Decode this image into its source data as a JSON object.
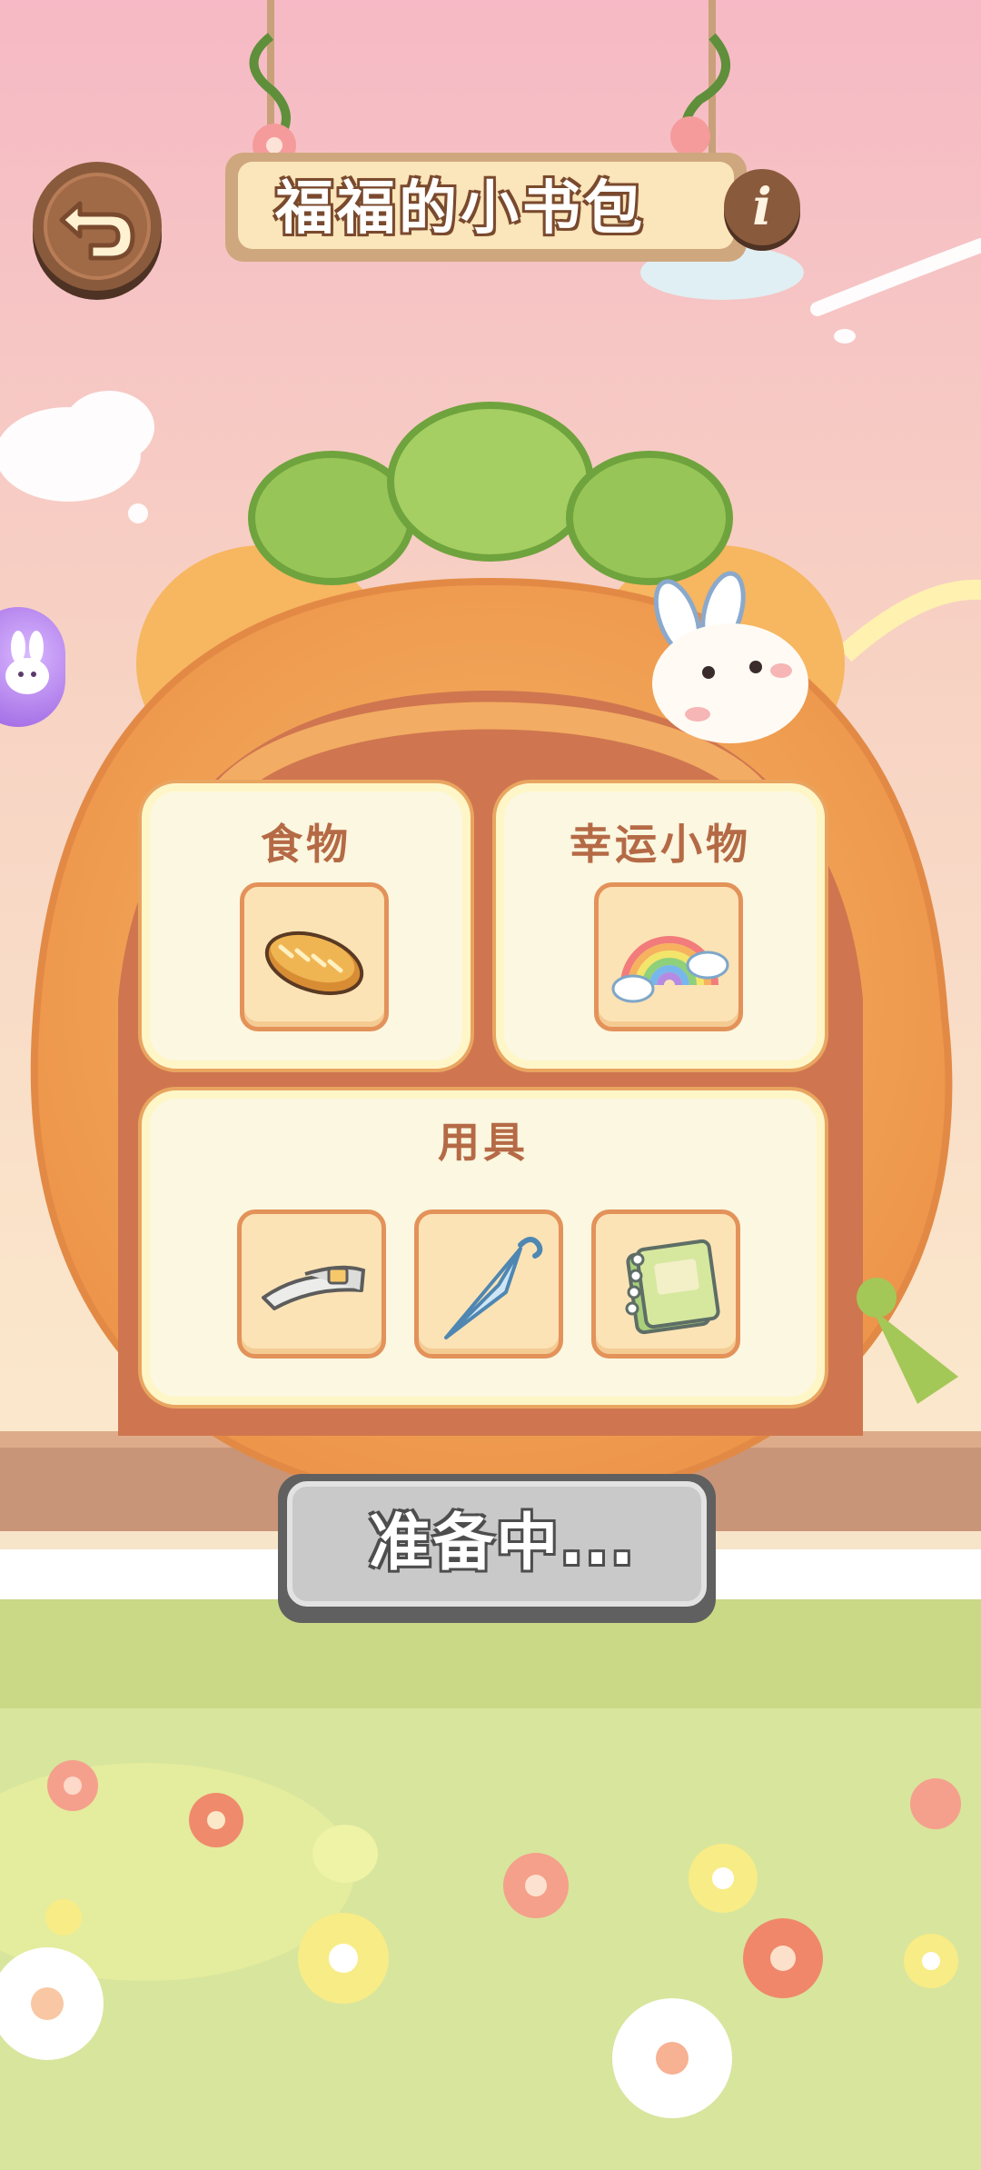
{
  "header": {
    "title": "福福的小书包",
    "back_icon": "return-arrow-icon",
    "info_glyph": "i"
  },
  "side_button": {
    "icon": "bunny-bubble-icon"
  },
  "backpack": {
    "sections": [
      {
        "label": "食物",
        "items": [
          {
            "icon": "bread-icon"
          }
        ]
      },
      {
        "label": "幸运小物",
        "items": [
          {
            "icon": "rainbow-icon"
          }
        ]
      },
      {
        "label": "用具",
        "items": [
          {
            "icon": "sun-visor-icon"
          },
          {
            "icon": "umbrella-icon"
          },
          {
            "icon": "notebook-icon"
          }
        ]
      }
    ]
  },
  "ready_button": {
    "label": "准备中..."
  },
  "colors": {
    "sky_top": "#f5bdc6",
    "sky_bottom": "#fae7c9",
    "grass": "#d6e49a",
    "backpack_orange": "#f2a04f",
    "panel_fill": "#fbf7e0",
    "label_brown": "#b56a46",
    "button_gray": "#c9c9c9"
  }
}
